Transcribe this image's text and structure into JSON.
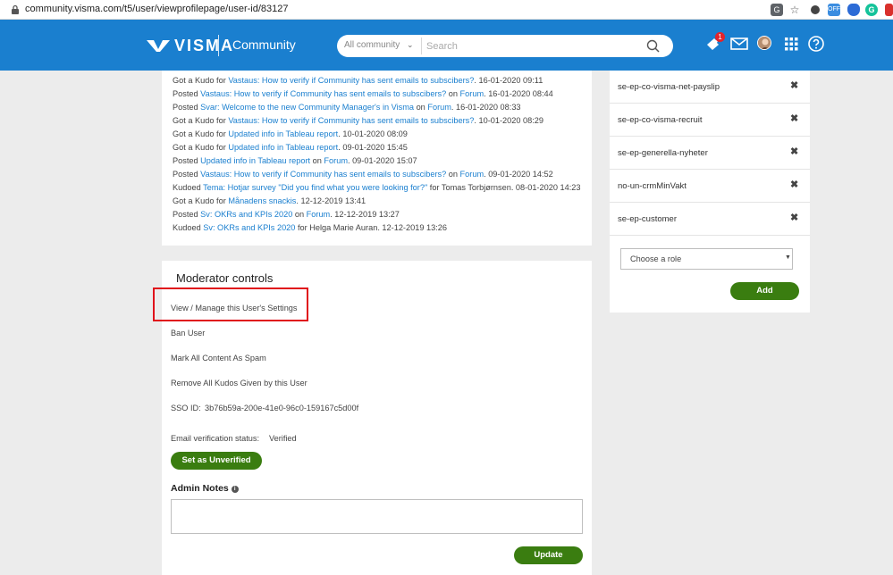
{
  "browser": {
    "url": "community.visma.com/t5/user/viewprofilepage/user-id/83127"
  },
  "header": {
    "logo_text": "VISMA",
    "title": "Community",
    "search_scope": "All community",
    "search_placeholder": "Search",
    "notification_count": "1",
    "icons": [
      "notification-icon",
      "mail-icon",
      "avatar",
      "apps-grid-icon",
      "help-icon"
    ],
    "brand_color": "#1a7fcf"
  },
  "activity": [
    {
      "prefix": "Got a Kudo for ",
      "link": "Vastaus: How to verify if Community has sent emails to subscibers?",
      "mid": "",
      "link2": "",
      "suffix": ". 16-01-2020 09:11"
    },
    {
      "prefix": "Posted ",
      "link": "Vastaus: How to verify if Community has sent emails to subscibers?",
      "mid": " on ",
      "link2": "Forum",
      "suffix": ". 16-01-2020 08:44"
    },
    {
      "prefix": "Posted ",
      "link": "Svar: Welcome to the new Community Manager's in Visma",
      "mid": " on ",
      "link2": "Forum",
      "suffix": ". 16-01-2020 08:33"
    },
    {
      "prefix": "Got a Kudo for ",
      "link": "Vastaus: How to verify if Community has sent emails to subscibers?",
      "mid": "",
      "link2": "",
      "suffix": ". 10-01-2020 08:29"
    },
    {
      "prefix": "Got a Kudo for ",
      "link": "Updated info in Tableau report",
      "mid": "",
      "link2": "",
      "suffix": ". 10-01-2020 08:09"
    },
    {
      "prefix": "Got a Kudo for ",
      "link": "Updated info in Tableau report",
      "mid": "",
      "link2": "",
      "suffix": ". 09-01-2020 15:45"
    },
    {
      "prefix": "Posted ",
      "link": "Updated info in Tableau report",
      "mid": " on ",
      "link2": "Forum",
      "suffix": ". 09-01-2020 15:07"
    },
    {
      "prefix": "Posted ",
      "link": "Vastaus: How to verify if Community has sent emails to subscibers?",
      "mid": " on ",
      "link2": "Forum",
      "suffix": ". 09-01-2020 14:52"
    },
    {
      "prefix": "Kudoed ",
      "link": "Tema: Hotjar survey \"Did you find what you were looking for?\"",
      "mid": "",
      "link2": "",
      "suffix": " for Tomas Torbjørnsen. 08-01-2020 14:23"
    },
    {
      "prefix": "Got a Kudo for ",
      "link": "Månadens snackis",
      "mid": "",
      "link2": "",
      "suffix": ". 12-12-2019 13:41"
    },
    {
      "prefix": "Posted ",
      "link": "Sv: OKRs and KPIs 2020",
      "mid": " on ",
      "link2": "Forum",
      "suffix": ". 12-12-2019 13:27"
    },
    {
      "prefix": "Kudoed ",
      "link": "Sv: OKRs and KPIs 2020",
      "mid": "",
      "link2": "",
      "suffix": " for Helga Marie Auran. 12-12-2019 13:26"
    }
  ],
  "moderator": {
    "title": "Moderator controls",
    "links": [
      "View / Manage this User's Settings",
      "Ban User",
      "Mark All Content As Spam",
      "Remove All Kudos Given by this User"
    ],
    "sso_label": "SSO ID:",
    "sso_value": "3b76b59a-200e-41e0-96c0-159167c5d00f",
    "email_status_label": "Email verification status:",
    "email_status_value": "Verified",
    "unverify_button": "Set as Unverified",
    "admin_notes_label": "Admin Notes",
    "update_button": "Update",
    "accent_color": "#3a7d10",
    "highlight_color": "#e0111b"
  },
  "roles": {
    "items": [
      "se-ep-co-visma-net-payslip",
      "se-ep-co-visma-recruit",
      "se-ep-generella-nyheter",
      "no-un-crmMinVakt",
      "se-ep-customer"
    ],
    "remove_glyph": "✖",
    "select_placeholder": "Choose a role",
    "add_button": "Add"
  }
}
